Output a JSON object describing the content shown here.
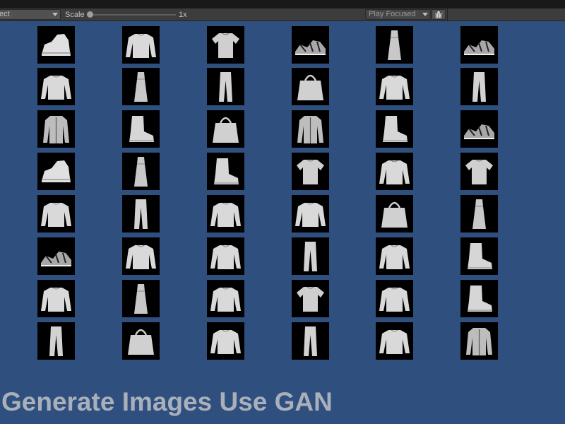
{
  "toolbar": {
    "aspect_value": "ect",
    "scale_label": "Scale",
    "scale_value": "1x",
    "play_mode_value": "Play Focused",
    "bug_icon": "bug-icon"
  },
  "gallery": {
    "rows": [
      [
        "sneaker",
        "sweater",
        "tshirt",
        "sandal",
        "dress",
        "sandal"
      ],
      [
        "sweater",
        "dress",
        "trouser",
        "bag",
        "sweater",
        "trouser"
      ],
      [
        "coat",
        "boot",
        "bag",
        "coat",
        "boot",
        "sandal"
      ],
      [
        "sneaker",
        "dress",
        "boot",
        "tshirt",
        "sweater",
        "tshirt"
      ],
      [
        "sweater",
        "trouser",
        "sweater",
        "sweater",
        "bag",
        "dress"
      ],
      [
        "sandal",
        "sweater",
        "sweater",
        "trouser",
        "sweater",
        "boot"
      ],
      [
        "sweater",
        "dress",
        "sweater",
        "tshirt",
        "sweater",
        "boot"
      ],
      [
        "trouser",
        "bag",
        "sweater",
        "trouser",
        "sweater",
        "coat"
      ]
    ]
  },
  "caption": {
    "text": "Generate Images Use GAN"
  },
  "colors": {
    "background": "#2f4f7f",
    "caption": "#a9b0ba",
    "toolbar": "#3c3c3c"
  }
}
